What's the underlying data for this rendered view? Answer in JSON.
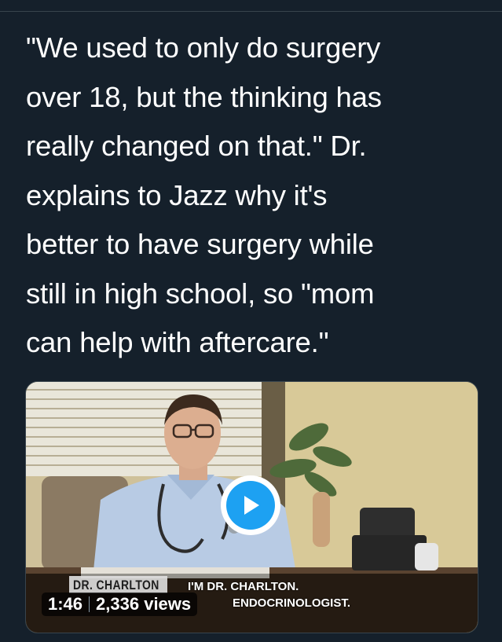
{
  "tweet": {
    "lines": [
      "\"We used to only do surgery",
      "over 18, but the thinking has",
      "really changed on that.\" Dr.",
      "explains to Jazz why it's",
      "better to have surgery while",
      "still in high school, so \"mom",
      "can help with aftercare.\""
    ]
  },
  "video": {
    "duration": "1:46",
    "views": "2,336 views",
    "play_icon": "play-icon",
    "chyron": {
      "name": "DR. CHARLTON",
      "line1": "I'M DR. CHARLTON.",
      "line2": "ENDOCRINOLOGIST."
    }
  },
  "colors": {
    "background": "#15202b",
    "accent": "#1da1f2",
    "text": "#ffffff",
    "divider": "#38444d"
  }
}
